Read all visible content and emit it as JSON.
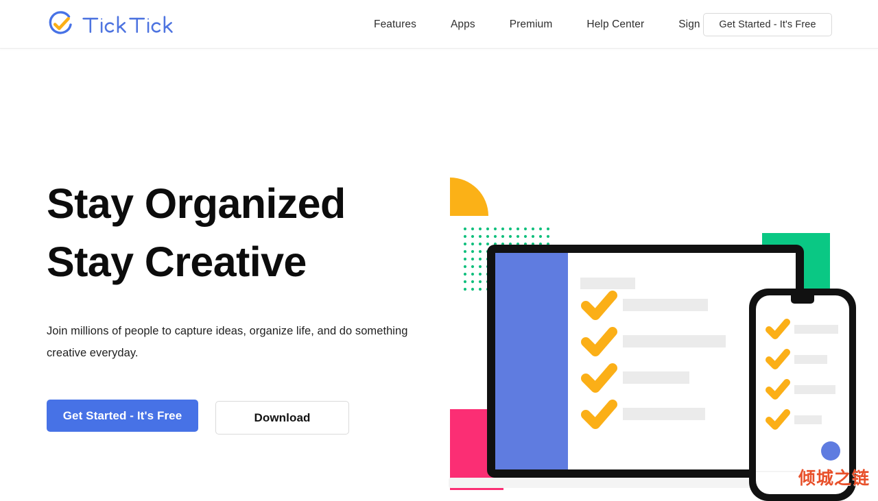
{
  "brand": {
    "name": "TickTick",
    "logo_icon": "ticktick-circle-check-icon",
    "logo_blue": "#4772e6",
    "logo_orange": "#fbaf17"
  },
  "header": {
    "nav_items": [
      {
        "label": "Features",
        "name": "nav-link-features"
      },
      {
        "label": "Apps",
        "name": "nav-link-apps"
      },
      {
        "label": "Premium",
        "name": "nav-link-premium"
      },
      {
        "label": "Help Center",
        "name": "nav-link-help-center"
      },
      {
        "label": "Sign In",
        "name": "nav-link-sign-in"
      }
    ],
    "cta_label": "Get Started - It's Free"
  },
  "hero": {
    "title_line1": "Stay Organized",
    "title_line2": "Stay Creative",
    "subtitle": "Join millions of people to capture ideas, organize life, and do something creative everyday.",
    "primary_button": "Get Started - It's Free",
    "secondary_button": "Download"
  },
  "illustration": {
    "name": "hero-devices-illustration",
    "description": "Laptop and phone mockups with orange checkmarks and gray task placeholder bars, surrounded by decorative shapes",
    "colors": {
      "laptop_frame": "#111111",
      "laptop_sidebar": "#5f7ce0",
      "laptop_base": "#f4f4f4",
      "checkmark_orange": "#fbaf17",
      "placeholder_gray": "#ebebeb",
      "quarter_circle_orange": "#fbb117",
      "dot_grid_green": "#13c07e",
      "square_green": "#0ac884",
      "square_pink": "#fb2e74",
      "phone_fab_blue": "#5f7ce0"
    },
    "laptop_tasks": 4,
    "phone_tasks": 4
  },
  "watermark": {
    "text": "倾城之链",
    "color": "#e8502a"
  }
}
